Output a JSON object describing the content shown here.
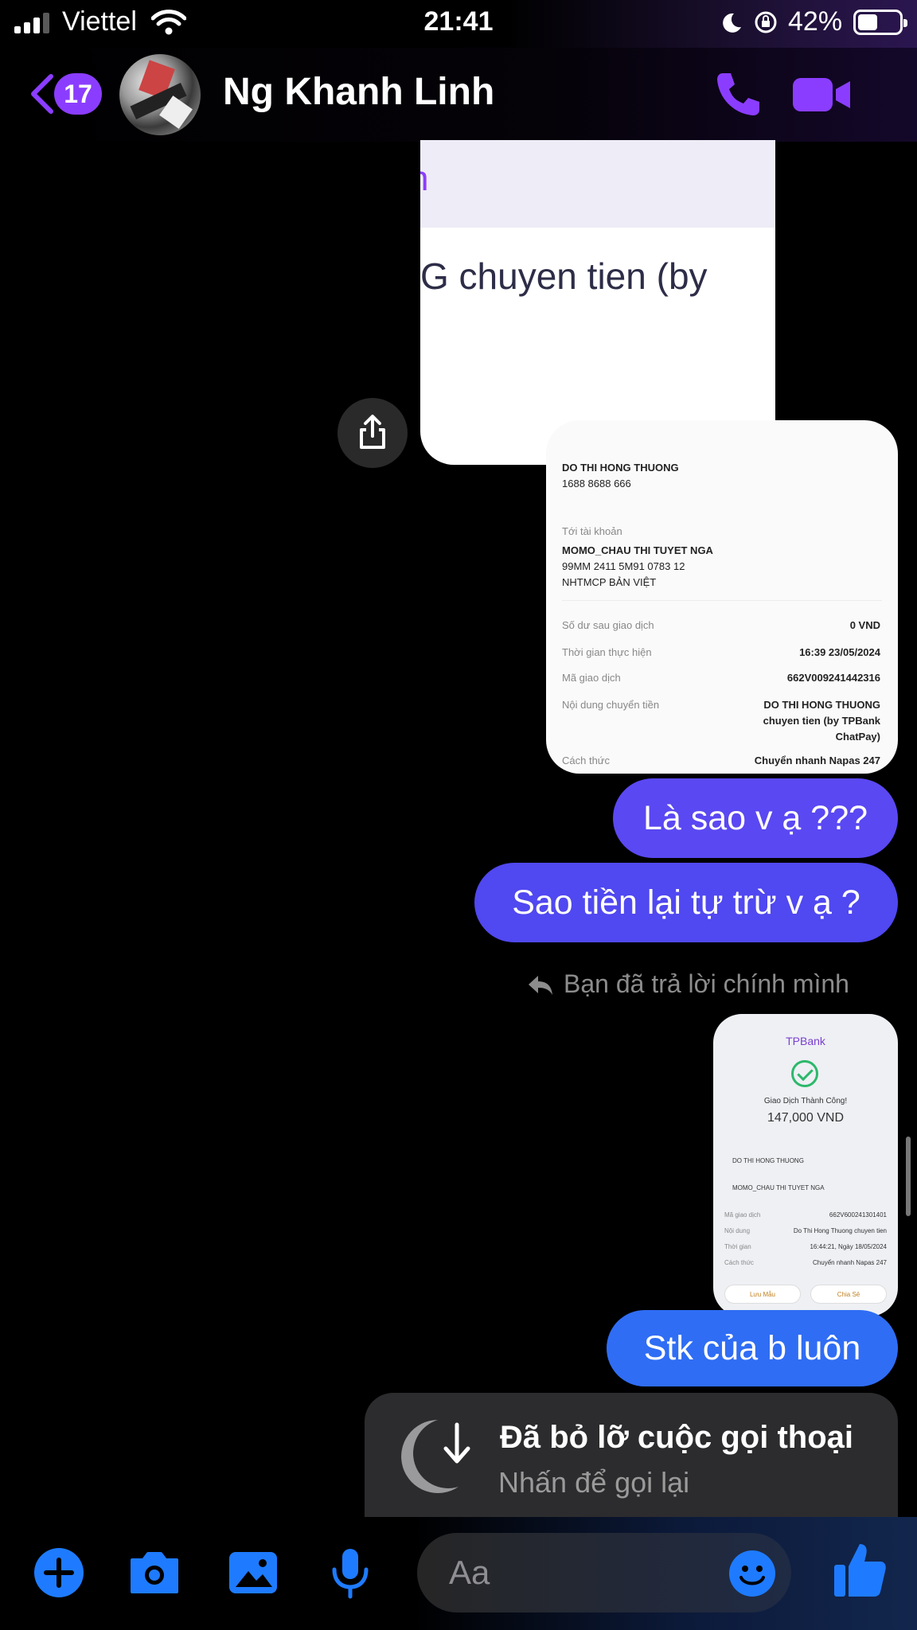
{
  "status_bar": {
    "carrier": "Viettel",
    "time": "21:41",
    "battery": "42%"
  },
  "header": {
    "unread_count": "17",
    "contact_name": "Ng Khanh Linh"
  },
  "shared_screenshot_top": {
    "title_fragment": "n",
    "line": "G chuyen tien (by"
  },
  "receipt": {
    "from_name": "DO THI HONG THUONG",
    "from_account": "1688 8688 666",
    "to_label": "Tới tài khoản",
    "to_name": "MOMO_CHAU THI TUYET NGA",
    "to_account": "99MM 2411 5M91 0783 12",
    "to_bank": "NHTMCP BẢN VIỆT",
    "rows": [
      {
        "label": "Số dư sau giao dịch",
        "value": "0 VND"
      },
      {
        "label": "Thời gian thực hiện",
        "value": "16:39 23/05/2024"
      },
      {
        "label": "Mã giao dịch",
        "value": "662V009241442316"
      },
      {
        "label": "Nội dung chuyển tiền",
        "value": "DO THI HONG THUONG",
        "value2": "chuyen tien (by TPBank",
        "value3": "ChatPay)"
      },
      {
        "label": "Cách thức",
        "value": "Chuyển nhanh Napas 247"
      }
    ]
  },
  "messages": [
    {
      "text": "Là sao v ạ ???"
    },
    {
      "text": "Sao tiền lại tự trừ v ạ ?"
    }
  ],
  "reply_note": "Bạn đã trả lời chính mình",
  "tpbank_receipt": {
    "logo": "TPBank",
    "status": "Giao Dịch Thành Công!",
    "amount": "147,000 VND",
    "from_name": "DO THI HONG THUONG",
    "to_name": "MOMO_CHAU THI TUYET NGA",
    "rows": [
      {
        "label": "Mã giao dịch",
        "value": "662V600241301401"
      },
      {
        "label": "Nội dung",
        "value": "Do Thi Hong Thuong chuyen tien"
      },
      {
        "label": "Thời gian",
        "value": "16:44:21, Ngày 18/05/2024"
      },
      {
        "label": "Cách thức",
        "value": "Chuyển nhanh Napas 247"
      }
    ],
    "btn_save": "Lưu Mẫu",
    "btn_share": "Chia Sẻ"
  },
  "last_message": "Stk của b luôn",
  "missed_call": {
    "title": "Đã bỏ lỡ cuộc gọi thoại",
    "subtitle": "Nhấn để gọi lại"
  },
  "composer": {
    "placeholder": "Aa"
  },
  "colors": {
    "accent_purple": "#8b3dff",
    "bubble_blue": "#4b4ff0",
    "icon_blue": "#1e7bff"
  }
}
